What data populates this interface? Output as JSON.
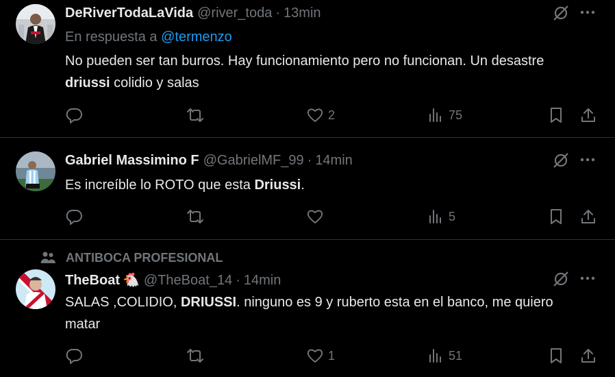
{
  "tweets": [
    {
      "name": "DeRiverTodaLaVida",
      "handle": "@river_toda",
      "dot": "·",
      "time": "13min",
      "reply_prefix": "En respuesta a",
      "reply_mention": "@termenzo",
      "text_parts": [
        "No pueden ser tan burros. Hay funcionamiento pero no funcionan. Un desastre ",
        "driussi",
        " colidio y salas"
      ],
      "likes": "2",
      "views": "75"
    },
    {
      "name": "Gabriel Massimino F",
      "handle": "@GabrielMF_99",
      "dot": "·",
      "time": "14min",
      "text_parts": [
        "Es increíble lo ROTO que esta ",
        "Driussi",
        "."
      ],
      "views": "5"
    },
    {
      "social_context": "ANTIBOCA PROFESIONAL",
      "name": "TheBoat",
      "name_emoji": "🐔",
      "handle": "@TheBoat_14",
      "dot": "·",
      "time": "14min",
      "text_parts": [
        "SALAS ,COLIDIO, ",
        "DRIUSSI",
        ". ninguno es 9 y ruberto esta en el banco, me quiero matar"
      ],
      "likes": "1",
      "views": "51"
    }
  ],
  "icons": {
    "reply": "reply-icon",
    "retweet": "retweet-icon",
    "like": "heart-icon",
    "views": "views-icon",
    "bookmark": "bookmark-icon",
    "share": "share-icon",
    "grok": "grok-icon",
    "more": "more-icon",
    "community": "community-icon"
  },
  "colors": {
    "background": "#000000",
    "text": "#e7e9ea",
    "muted": "#71767b",
    "link": "#1d9bf0",
    "divider": "#2f3336"
  }
}
